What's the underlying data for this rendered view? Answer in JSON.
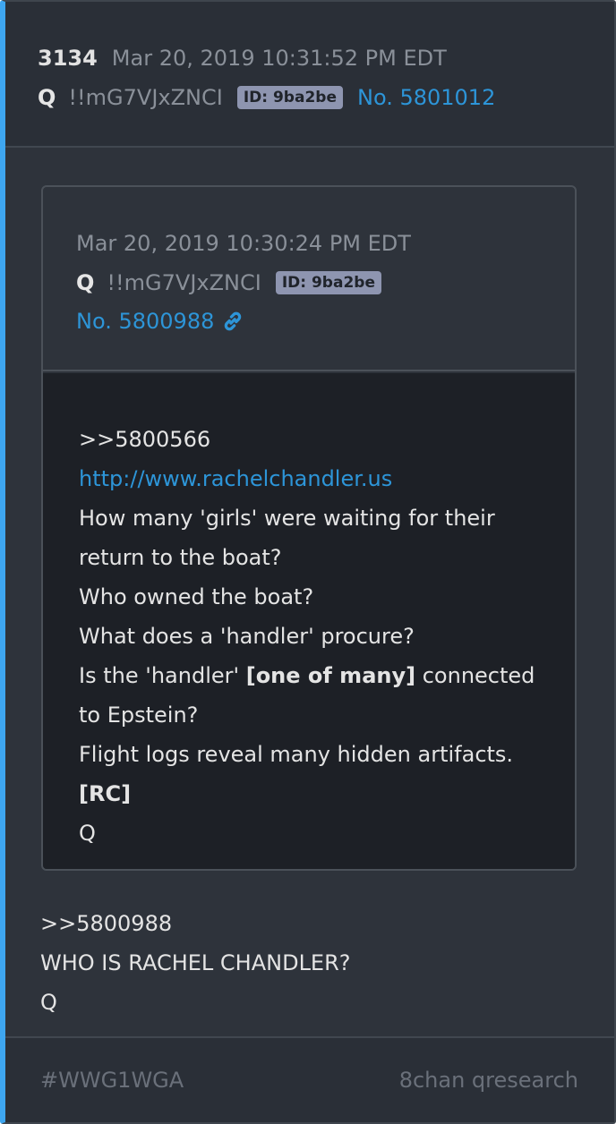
{
  "post": {
    "number": "3134",
    "date": "Mar 20, 2019 10:31:52 PM EDT",
    "name": "Q",
    "tripcode": "!!mG7VJxZNCI",
    "id_badge": "ID: 9ba2be",
    "post_no": "No. 5801012"
  },
  "quoted": {
    "date": "Mar 20, 2019 10:30:24 PM EDT",
    "name": "Q",
    "tripcode": "!!mG7VJxZNCI",
    "id_badge": "ID: 9ba2be",
    "post_no": "No. 5800988",
    "link_icon": "link-icon",
    "lines": {
      "l1": ">>5800566",
      "l2": "http://www.rachelchandler.us",
      "l3a": "How many 'girls' were waiting for their",
      "l3b": "return to the boat?",
      "l4": "Who owned the boat?",
      "l5": "What does a 'handler' procure?",
      "l6_pre": "Is the 'handler' ",
      "l6_bold": "[one of many]",
      "l6_post": " connected",
      "l6b": "to Epstein?",
      "l7": "Flight logs reveal many hidden artifacts.",
      "l8": "[RC]",
      "l9": "Q"
    }
  },
  "body": {
    "l1": ">>5800988",
    "l2": "WHO IS RACHEL CHANDLER?",
    "l3": "Q"
  },
  "footer": {
    "tag": "#WWG1WGA",
    "source": "8chan qresearch"
  },
  "colors": {
    "accent": "#3ea6f0",
    "link": "#2d95d8",
    "badge": "#8e95b0"
  }
}
